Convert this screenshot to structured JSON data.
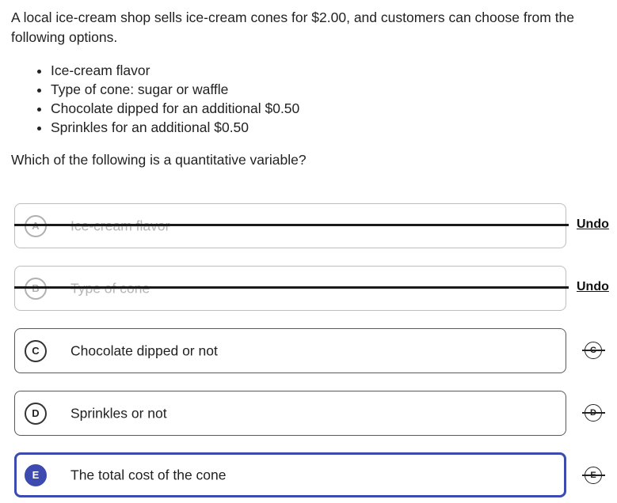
{
  "question": {
    "intro": "A local ice-cream shop sells ice-cream cones for $2.00, and customers can choose from the following options.",
    "options": [
      "Ice-cream flavor",
      "Type of cone: sugar or waffle",
      "Chocolate dipped for an additional $0.50",
      "Sprinkles for an additional $0.50"
    ],
    "prompt": "Which of the following is a quantitative variable?"
  },
  "choices": [
    {
      "letter": "A",
      "text": "Ice-cream flavor",
      "state": "eliminated",
      "undo_label": "Undo"
    },
    {
      "letter": "B",
      "text": "Type of cone",
      "state": "eliminated",
      "undo_label": "Undo"
    },
    {
      "letter": "C",
      "text": "Chocolate dipped or not",
      "state": "normal"
    },
    {
      "letter": "D",
      "text": "Sprinkles or not",
      "state": "normal"
    },
    {
      "letter": "E",
      "text": "The total cost of the cone",
      "state": "selected"
    }
  ],
  "colors": {
    "selected_accent": "#3d4ab0",
    "eliminated_text": "#b3b3b3"
  }
}
